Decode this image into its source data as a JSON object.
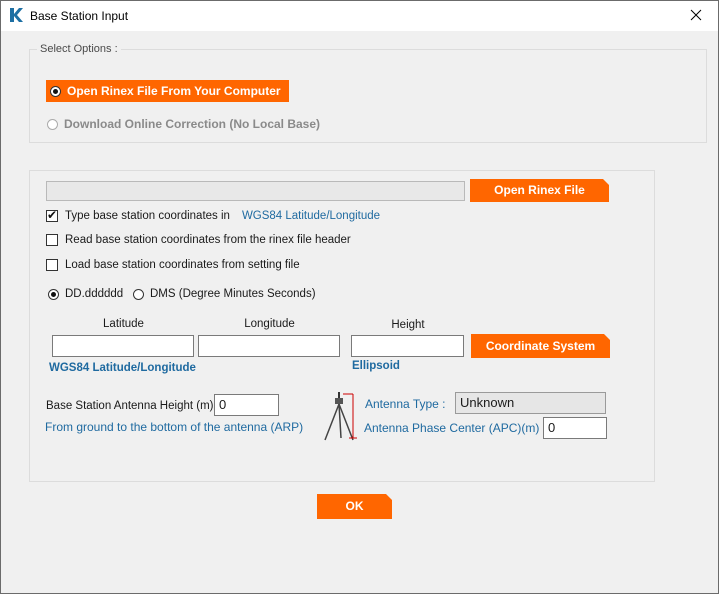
{
  "window": {
    "title": "Base Station Input"
  },
  "select_options": {
    "legend": "Select Options :",
    "option_open_rinex": "Open Rinex File From Your Computer",
    "option_download_online": "Download Online Correction (No Local Base)",
    "selected": "open_rinex"
  },
  "rinex": {
    "path_value": "",
    "open_button": "Open Rinex File"
  },
  "coordinate_options": {
    "type_coords": {
      "label": "Type base station coordinates in",
      "checked": true,
      "system": "WGS84 Latitude/Longitude"
    },
    "read_header": {
      "label": "Read base station coordinates from the rinex file header",
      "checked": false
    },
    "load_setting": {
      "label": "Load base station coordinates from setting file",
      "checked": false
    }
  },
  "format": {
    "dd_label": "DD.dddddd",
    "dms_label": "DMS (Degree Minutes Seconds)",
    "selected": "dd"
  },
  "coordinates": {
    "latitude_label": "Latitude",
    "longitude_label": "Longitude",
    "height_label": "Height",
    "latitude_value": "",
    "longitude_value": "",
    "height_value": "",
    "coord_system_button": "Coordinate System",
    "system_caption": "WGS84 Latitude/Longitude",
    "height_caption": "Ellipsoid"
  },
  "antenna": {
    "height_label": "Base Station Antenna Height (m)",
    "height_value": "0",
    "height_hint": "From ground to the bottom of the antenna (ARP)",
    "type_label": "Antenna Type :",
    "type_value": "Unknown",
    "apc_label": "Antenna Phase Center (APC)(m)",
    "apc_value": "0"
  },
  "ok_button": "OK",
  "colors": {
    "accent": "#ff6600",
    "link_blue": "#1f6aa0",
    "background": "#f0f0f0"
  }
}
